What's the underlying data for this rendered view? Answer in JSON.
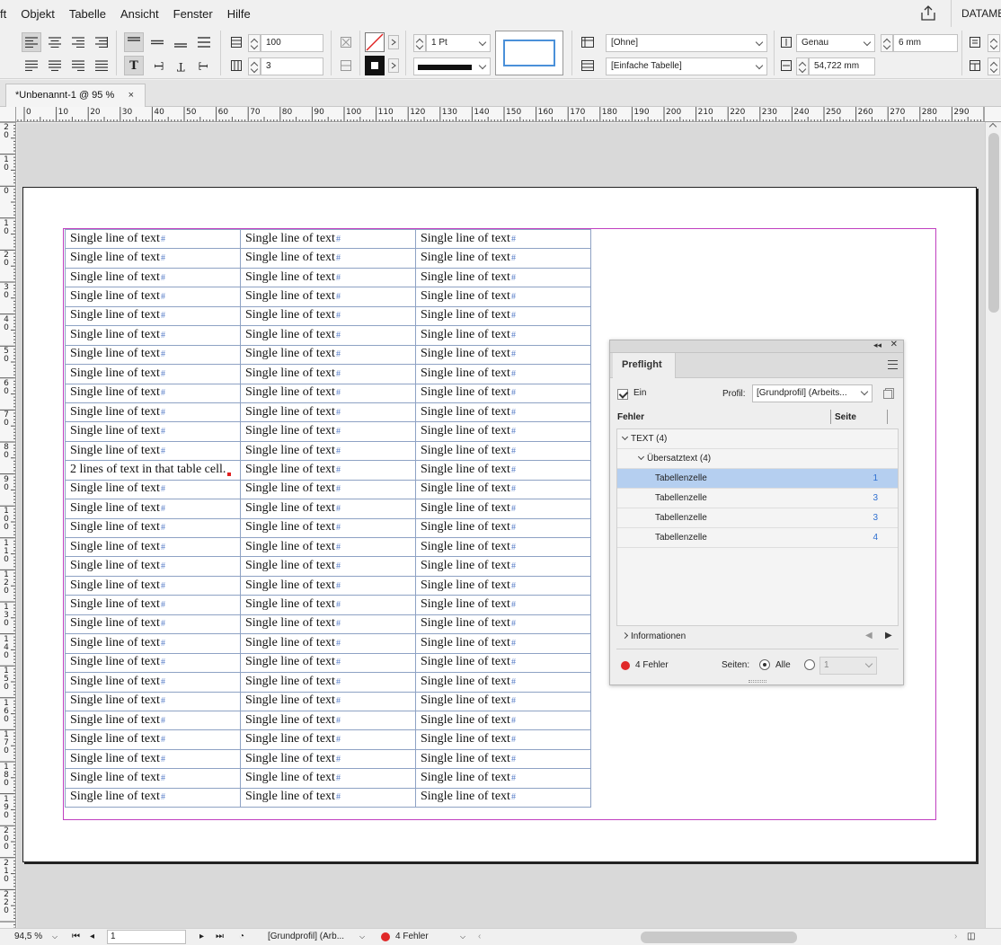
{
  "menubar": {
    "items": [
      "ft",
      "Objekt",
      "Tabelle",
      "Ansicht",
      "Fenster",
      "Hilfe"
    ],
    "right_label": "DATAME"
  },
  "controlbar": {
    "row_count": "100",
    "column_count": "3",
    "stroke_weight": "1 Pt",
    "cell_style": "[Ohne]",
    "table_style": "[Einfache Tabelle]",
    "row_height_mode": "Genau",
    "row_height": "6 mm",
    "column_width": "54,722 mm"
  },
  "document": {
    "tab_title": "*Unbenannt-1 @ 95 %",
    "tab_close": "×"
  },
  "ruler": {
    "top_labels": [
      "0",
      "10",
      "20",
      "30",
      "40",
      "50",
      "60",
      "70",
      "80",
      "90",
      "100",
      "110",
      "120",
      "130",
      "140",
      "150",
      "160",
      "170",
      "180",
      "190",
      "200",
      "210",
      "220",
      "230",
      "240",
      "250",
      "260",
      "270",
      "280",
      "290"
    ],
    "left_labels": [
      "20",
      "10",
      "0",
      "10",
      "20",
      "30",
      "40",
      "50",
      "60",
      "70",
      "80",
      "90",
      "100",
      "110",
      "120",
      "130",
      "140",
      "150",
      "160",
      "170",
      "180",
      "190",
      "200",
      "210",
      "220"
    ]
  },
  "table": {
    "default_text": "Single line of text",
    "overset_text": "2 lines of text in that table cell.",
    "overset_row_index": 12,
    "row_count": 30,
    "col_count": 3,
    "paragraph_mark": "#"
  },
  "preflight": {
    "tab_label": "Preflight",
    "on_label": "Ein",
    "profile_label": "Profil:",
    "profile_value": "[Grundprofil] (Arbeits...",
    "col_errors": "Fehler",
    "col_page": "Seite",
    "tree": [
      {
        "label": "TEXT (4)",
        "indent": 0,
        "expanded": true,
        "page": "",
        "selected": false
      },
      {
        "label": "Übersatztext (4)",
        "indent": 1,
        "expanded": true,
        "page": "",
        "selected": false
      },
      {
        "label": "Tabellenzelle",
        "indent": 2,
        "page": "1",
        "selected": true
      },
      {
        "label": "Tabellenzelle",
        "indent": 2,
        "page": "3",
        "selected": false
      },
      {
        "label": "Tabellenzelle",
        "indent": 2,
        "page": "3",
        "selected": false
      },
      {
        "label": "Tabellenzelle",
        "indent": 2,
        "page": "4",
        "selected": false
      }
    ],
    "info_label": "Informationen",
    "error_count": "4 Fehler",
    "pages_label": "Seiten:",
    "all_label": "Alle",
    "page_range": "1",
    "error_color": "#e02828"
  },
  "statusbar": {
    "zoom": "94,5 %",
    "page": "1",
    "profile": "[Grundprofil] (Arb...",
    "errors": "4 Fehler"
  },
  "colors": {
    "accent_selected": "#b5cff0",
    "margin_guide": "#c040c0",
    "table_stroke": "#8ea2c4"
  }
}
